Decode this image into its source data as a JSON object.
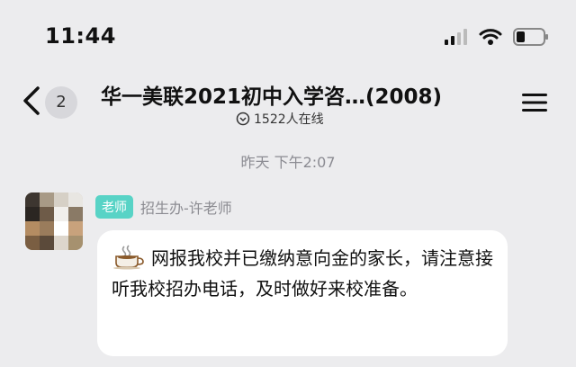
{
  "status_bar": {
    "time": "11:44"
  },
  "nav": {
    "unread_count": "2",
    "title": "华一美联2021初中入学咨…(2008)",
    "online_text": "1522人在线"
  },
  "message": {
    "timestamp": "昨天 下午2:07",
    "sender_role_badge": "老师",
    "sender_name": "招生办-许老师",
    "text": "网报我校并已缴纳意向金的家长，请注意接听我校招办电话，及时做好来校准备。",
    "emoji": "coffee-cup-icon"
  },
  "colors": {
    "badge": "#58d3c6",
    "background": "#ececee",
    "bubble": "#ffffff"
  }
}
